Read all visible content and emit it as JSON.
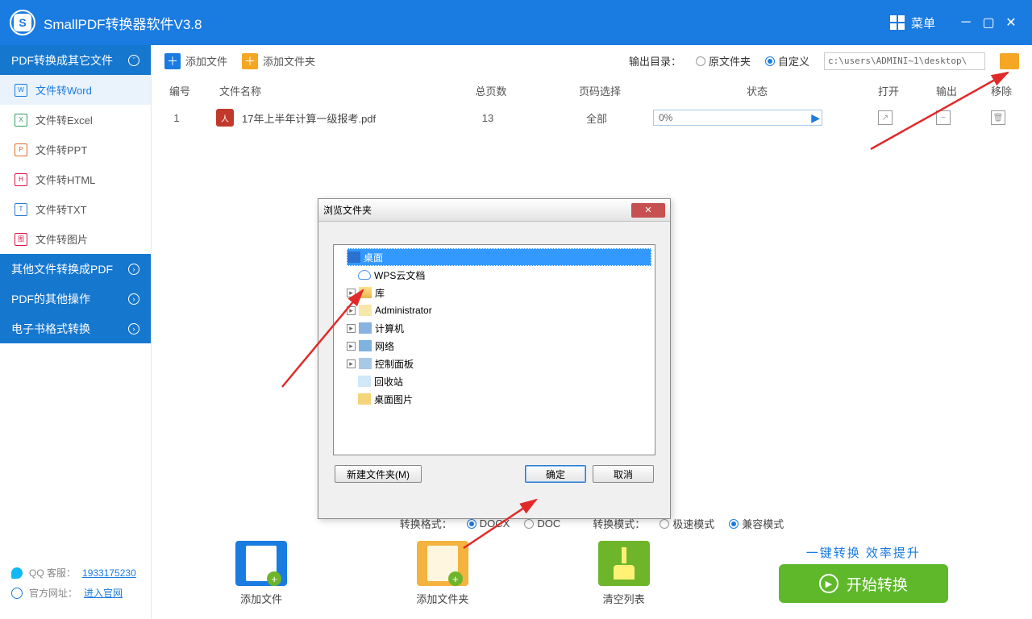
{
  "title": "SmallPDF转换器软件V3.8",
  "menu": "菜单",
  "sidebar": {
    "section1": "PDF转换成其它文件",
    "items": [
      "文件转Word",
      "文件转Excel",
      "文件转PPT",
      "文件转HTML",
      "文件转TXT",
      "文件转图片"
    ],
    "icons": [
      "W",
      "X",
      "P",
      "H",
      "T",
      "图"
    ],
    "section2": "其他文件转换成PDF",
    "section3": "PDF的其他操作",
    "section4": "电子书格式转换"
  },
  "toolbar": {
    "add_file": "添加文件",
    "add_folder": "添加文件夹",
    "out_label": "输出目录：",
    "orig_folder": "原文件夹",
    "custom": "自定义",
    "path": "c:\\users\\ADMINI~1\\desktop\\"
  },
  "table": {
    "headers": {
      "num": "编号",
      "name": "文件名称",
      "pages": "总页数",
      "sel": "页码选择",
      "status": "状态",
      "open": "打开",
      "out": "输出",
      "del": "移除"
    },
    "rows": [
      {
        "num": "1",
        "name": "17年上半年计算一级报考.pdf",
        "pages": "13",
        "sel": "全部",
        "pct": "0%"
      }
    ]
  },
  "options": {
    "fmt_label": "转换格式：",
    "fmt1": "DOCX",
    "fmt2": "DOC",
    "mode_label": "转换模式：",
    "mode1": "极速模式",
    "mode2": "兼容模式"
  },
  "actions": {
    "add_file": "添加文件",
    "add_folder": "添加文件夹",
    "clear": "清空列表"
  },
  "slogan": "一键转换  效率提升",
  "start": "开始转换",
  "footer": {
    "qq_label": "QQ 客服：",
    "qq": "1933175230",
    "site_label": "官方网址：",
    "site": "进入官网"
  },
  "dialog": {
    "title": "浏览文件夹",
    "nodes": [
      "桌面",
      "WPS云文档",
      "库",
      "Administrator",
      "计算机",
      "网络",
      "控制面板",
      "回收站",
      "桌面图片"
    ],
    "new_folder": "新建文件夹(M)",
    "ok": "确定",
    "cancel": "取消"
  }
}
